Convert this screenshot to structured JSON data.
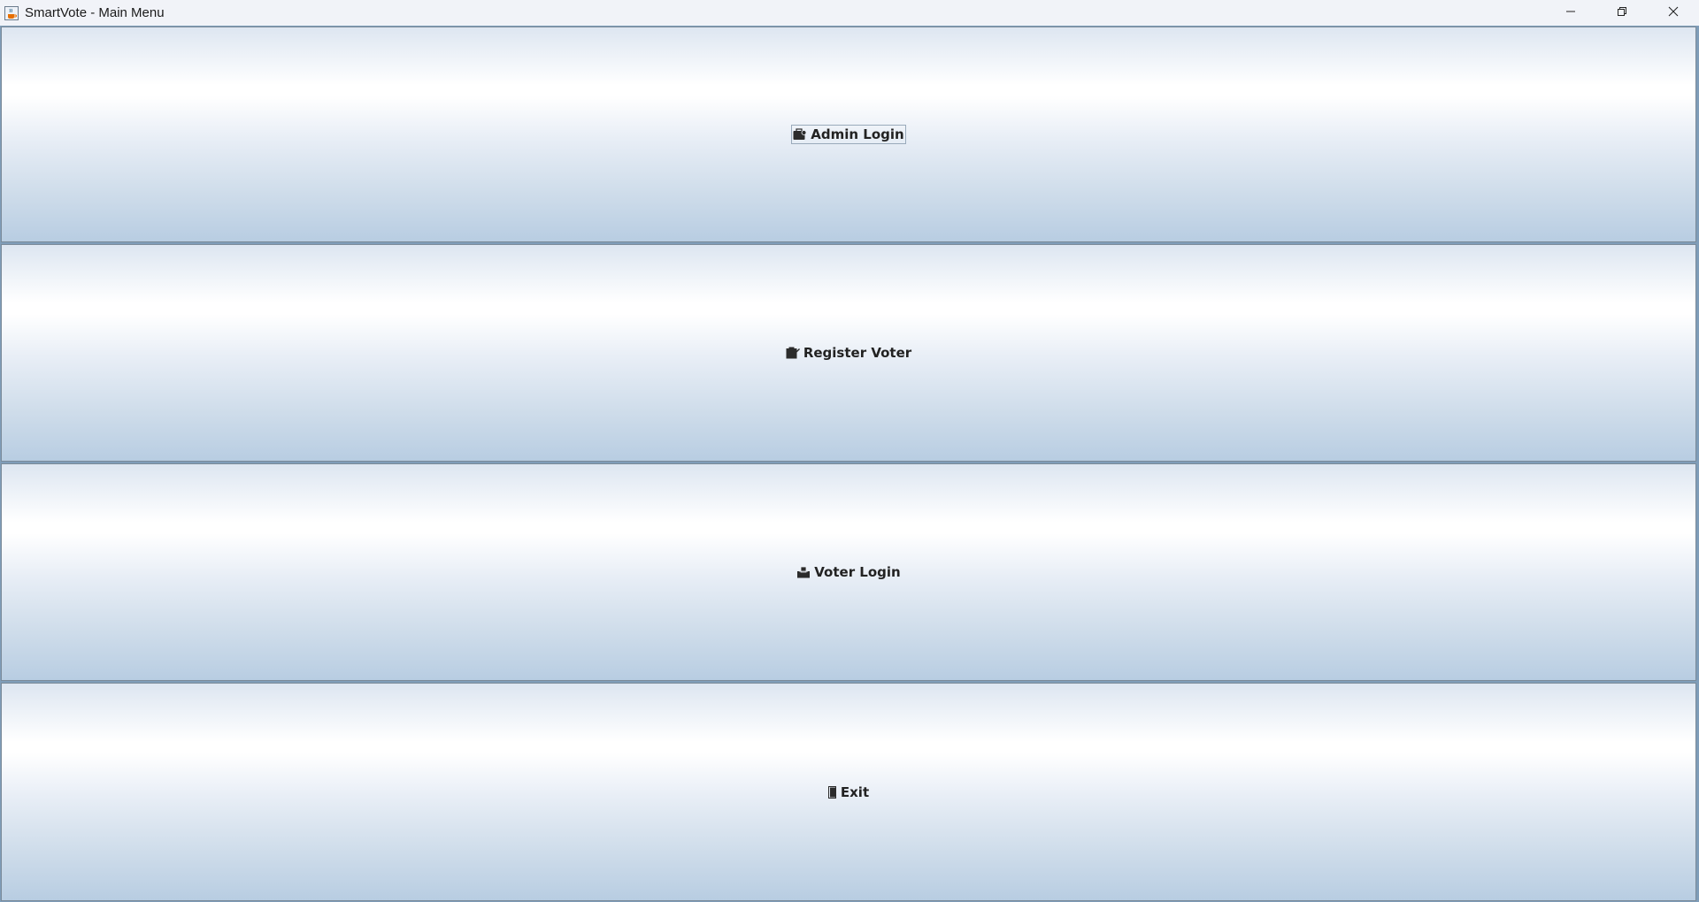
{
  "window": {
    "title": "SmartVote - Main Menu",
    "app_icon": "java-cup-icon"
  },
  "controls": {
    "minimize_icon": "minimize-icon",
    "maximize_icon": "restore-icon",
    "close_icon": "close-icon"
  },
  "menu": {
    "buttons": [
      {
        "label": "Admin Login",
        "icon": "briefcase-icon",
        "focused": true
      },
      {
        "label": "Register Voter",
        "icon": "clipboard-icon",
        "focused": false
      },
      {
        "label": "Voter Login",
        "icon": "ballot-box-icon",
        "focused": false
      },
      {
        "label": "Exit",
        "icon": "door-icon",
        "focused": false
      }
    ]
  },
  "colors": {
    "border": "#7a8a99",
    "gradient_top": "#dde6f1",
    "gradient_mid": "#ffffff",
    "gradient_bottom": "#b8cde2",
    "text": "#222222"
  }
}
